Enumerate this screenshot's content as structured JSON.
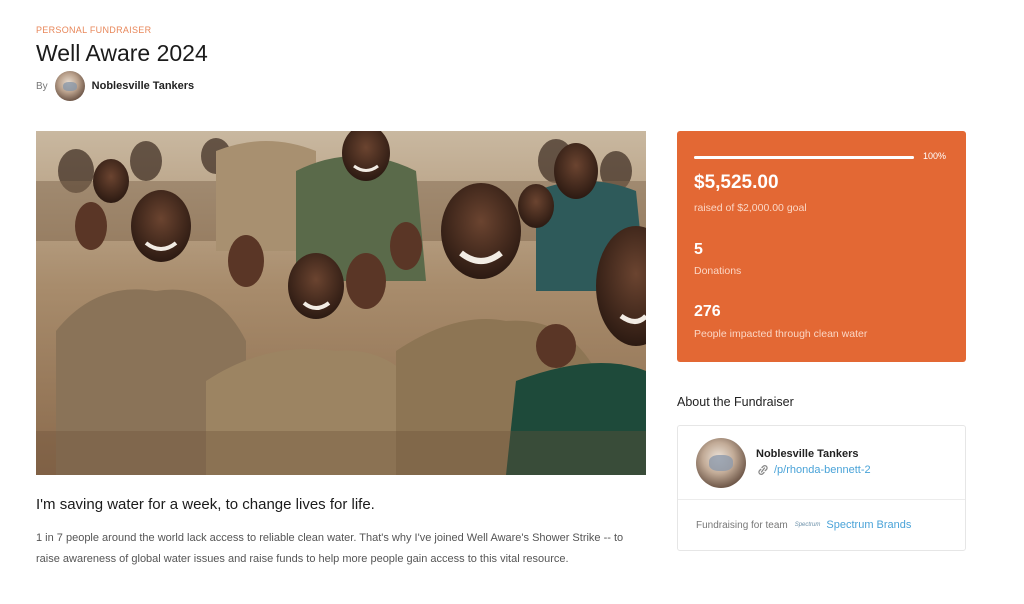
{
  "header": {
    "eyebrow": "PERSONAL FUNDRAISER",
    "title": "Well Aware 2024",
    "by_label": "By",
    "author": "Noblesville Tankers"
  },
  "stats": {
    "progress_fraction": 1.0,
    "progress_percent": "100%",
    "raised": "$5,525.00",
    "raised_label": "raised of $2,000.00 goal",
    "donations": "5",
    "donations_label": "Donations",
    "impacted": "276",
    "impacted_label": "People impacted through clean water",
    "accent_color": "#e36834"
  },
  "story": {
    "subheading": "I'm saving water for a week, to change lives for life.",
    "body": "1 in 7 people around the world lack access to reliable clean water. That's why I've joined Well Aware's Shower Strike -- to raise awareness of global water issues and raise funds to help more people gain access to this vital resource."
  },
  "about": {
    "title": "About the Fundraiser",
    "name": "Noblesville Tankers",
    "link": "/p/rhonda-bennett-2",
    "team_label": "Fundraising for team",
    "team_logo_text": "Spectrum",
    "team_name": "Spectrum Brands"
  },
  "icons": {
    "link": "link-icon"
  }
}
